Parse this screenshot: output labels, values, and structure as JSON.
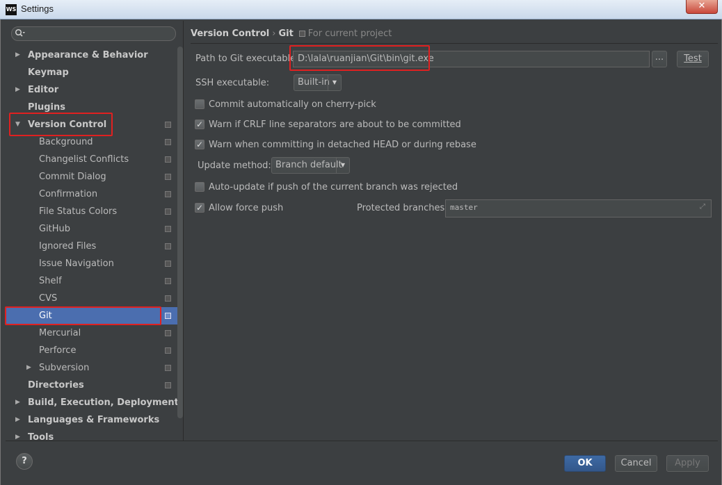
{
  "window": {
    "title": "Settings",
    "logo": "WS",
    "close_label": "✕"
  },
  "search": {
    "placeholder": "",
    "icon": "search-icon"
  },
  "sidebar": {
    "items": [
      {
        "label": "Appearance & Behavior",
        "level": 0,
        "arrow": "▶",
        "bold": true
      },
      {
        "label": "Keymap",
        "level": 0,
        "arrow": "",
        "bold": true
      },
      {
        "label": "Editor",
        "level": 0,
        "arrow": "▶",
        "bold": true
      },
      {
        "label": "Plugins",
        "level": 0,
        "arrow": "",
        "bold": true
      },
      {
        "label": "Version Control",
        "level": 0,
        "arrow": "▼",
        "bold": true
      },
      {
        "label": "Background",
        "level": 1,
        "arrow": ""
      },
      {
        "label": "Changelist Conflicts",
        "level": 1,
        "arrow": ""
      },
      {
        "label": "Commit Dialog",
        "level": 1,
        "arrow": ""
      },
      {
        "label": "Confirmation",
        "level": 1,
        "arrow": ""
      },
      {
        "label": "File Status Colors",
        "level": 1,
        "arrow": ""
      },
      {
        "label": "GitHub",
        "level": 1,
        "arrow": ""
      },
      {
        "label": "Ignored Files",
        "level": 1,
        "arrow": ""
      },
      {
        "label": "Issue Navigation",
        "level": 1,
        "arrow": ""
      },
      {
        "label": "Shelf",
        "level": 1,
        "arrow": ""
      },
      {
        "label": "CVS",
        "level": 1,
        "arrow": ""
      },
      {
        "label": "Git",
        "level": 1,
        "arrow": "",
        "selected": true
      },
      {
        "label": "Mercurial",
        "level": 1,
        "arrow": ""
      },
      {
        "label": "Perforce",
        "level": 1,
        "arrow": ""
      },
      {
        "label": "Subversion",
        "level": 1,
        "arrow": "▶"
      },
      {
        "label": "Directories",
        "level": 0,
        "arrow": "",
        "bold": true
      },
      {
        "label": "Build, Execution, Deployment",
        "level": 0,
        "arrow": "▶",
        "bold": true
      },
      {
        "label": "Languages & Frameworks",
        "level": 0,
        "arrow": "▶",
        "bold": true
      },
      {
        "label": "Tools",
        "level": 0,
        "arrow": "▶",
        "bold": true
      }
    ]
  },
  "breadcrumb": {
    "part1": "Version Control",
    "separator": "›",
    "part2": "Git",
    "note": "For current project"
  },
  "git": {
    "path_label": "Path to Git executable:",
    "path_value": "D:\\lala\\ruanjian\\Git\\bin\\git.exe",
    "browse_label": "...",
    "test_label": "Test",
    "ssh_label": "SSH executable:",
    "ssh_value": "Built-in",
    "cherry_pick_label": "Commit automatically on cherry-pick",
    "cherry_pick_checked": false,
    "crlf_label": "Warn if CRLF line separators are about to be committed",
    "crlf_checked": true,
    "detached_label": "Warn when committing in detached HEAD or during rebase",
    "detached_checked": true,
    "update_method_label": "Update method:",
    "update_method_value": "Branch default",
    "auto_update_label": "Auto-update if push of the current branch was rejected",
    "auto_update_checked": false,
    "force_push_label": "Allow force push",
    "force_push_checked": true,
    "protected_label": "Protected branches:",
    "protected_value": "master"
  },
  "footer": {
    "help_label": "?",
    "ok_label": "OK",
    "cancel_label": "Cancel",
    "apply_label": "Apply"
  },
  "colors": {
    "background": "#3c3f41",
    "selection": "#4b6eaf",
    "highlight_box": "#e02020",
    "ok_button": "#365880"
  }
}
